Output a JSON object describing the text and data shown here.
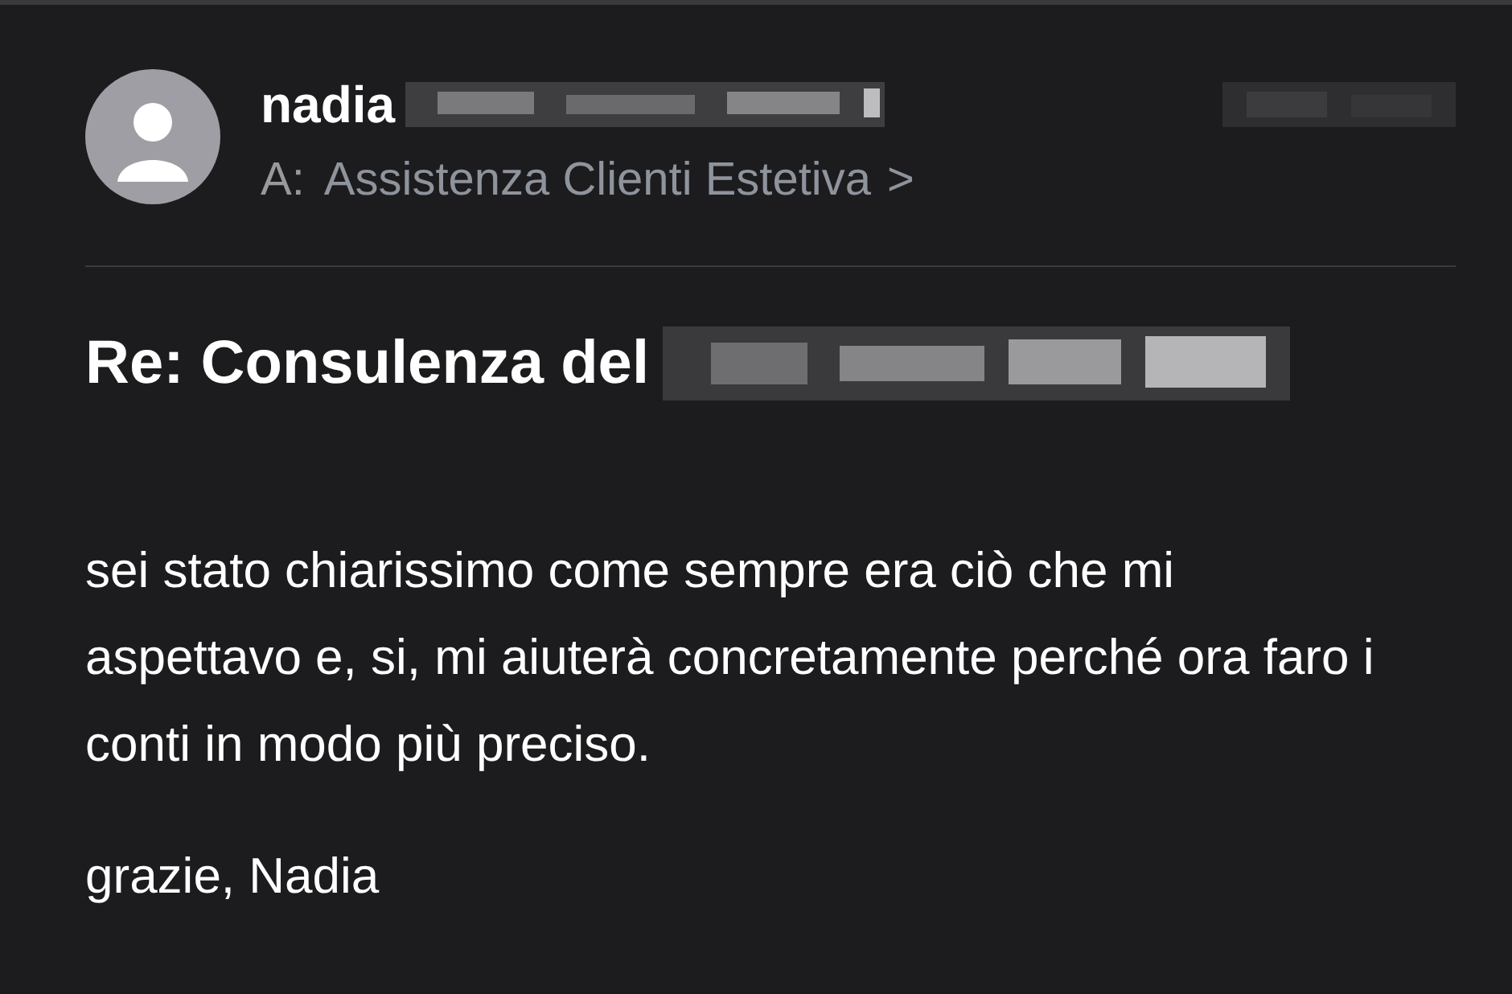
{
  "sender": {
    "name": "nadia"
  },
  "recipient": {
    "prefix": "A:",
    "name": "Assistenza Clienti Estetiva",
    "chevron": ">"
  },
  "subject": "Re: Consulenza del",
  "body": [
    {
      "kind": "paragraph",
      "text": "sei stato chiarissimo come sempre era ciò che mi aspettavo e, si, mi aiuterà concretamente perché ora faro i conti in modo più preciso."
    },
    {
      "kind": "paragraph",
      "text": "grazie, Nadia"
    }
  ]
}
